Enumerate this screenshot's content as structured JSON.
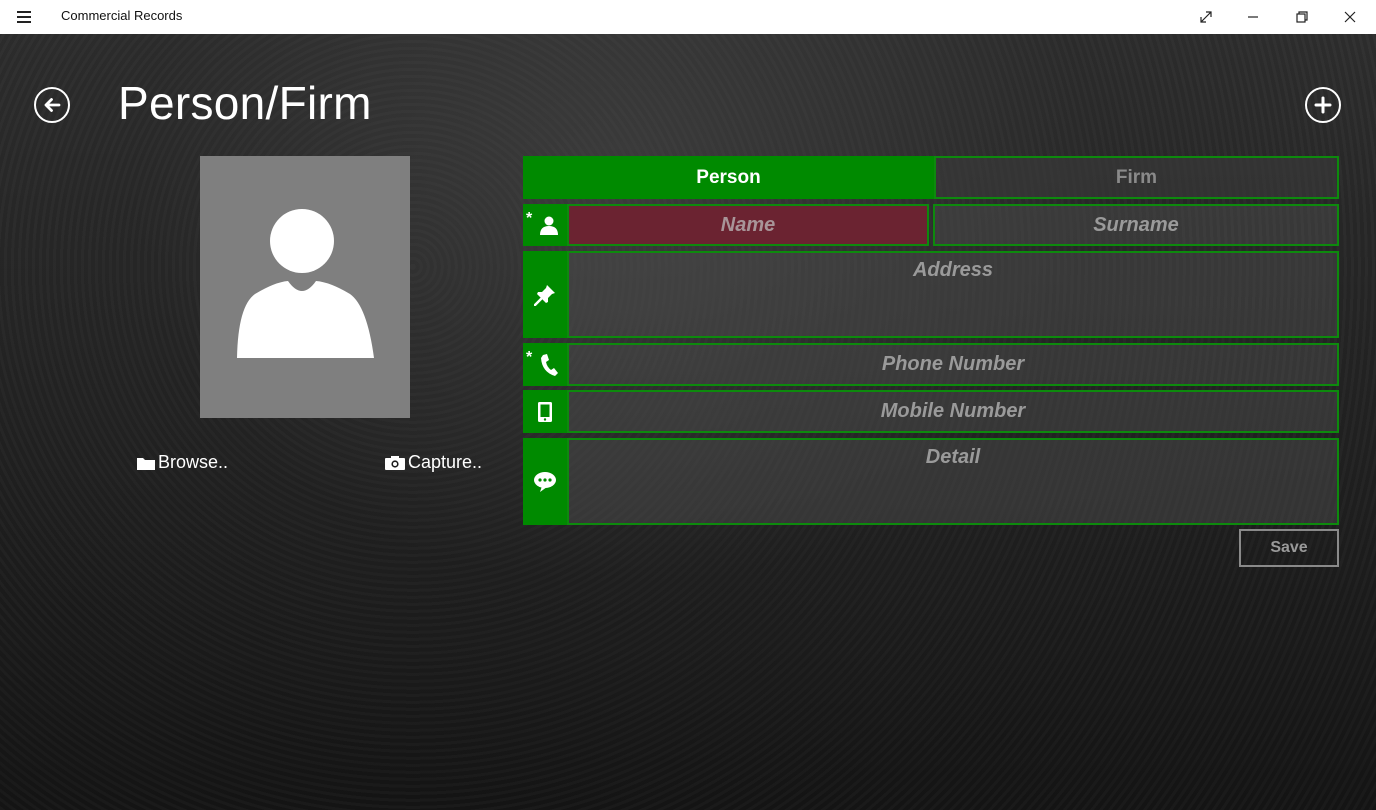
{
  "window": {
    "app_title": "Commercial Records",
    "buttons": [
      "menu",
      "expand",
      "minimize",
      "restore",
      "close"
    ]
  },
  "page": {
    "title": "Person/Firm",
    "back_icon": "arrow-left-icon",
    "add_icon": "plus-icon"
  },
  "photo": {
    "placeholder_icon": "user-silhouette-icon",
    "browse_label": "Browse..",
    "capture_label": "Capture.."
  },
  "tabs": {
    "person": "Person",
    "firm": "Firm",
    "active": "Person"
  },
  "form": {
    "name_placeholder": "Name",
    "surname_placeholder": "Surname",
    "address_placeholder": "Address",
    "phone_placeholder": "Phone Number",
    "mobile_placeholder": "Mobile Number",
    "detail_placeholder": "Detail",
    "required_marker": "*",
    "save_label": "Save"
  },
  "colors": {
    "accent_green": "#008a00",
    "name_invalid_bg": "#6b2331",
    "avatar_bg": "#7f7f7f"
  }
}
